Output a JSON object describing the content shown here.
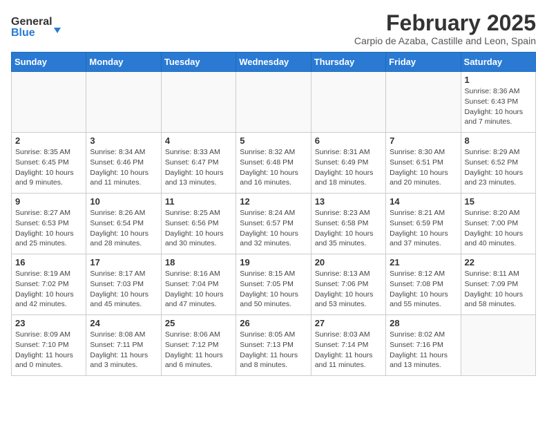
{
  "header": {
    "logo_general": "General",
    "logo_blue": "Blue",
    "month_title": "February 2025",
    "subtitle": "Carpio de Azaba, Castille and Leon, Spain"
  },
  "weekdays": [
    "Sunday",
    "Monday",
    "Tuesday",
    "Wednesday",
    "Thursday",
    "Friday",
    "Saturday"
  ],
  "weeks": [
    [
      {
        "day": "",
        "info": ""
      },
      {
        "day": "",
        "info": ""
      },
      {
        "day": "",
        "info": ""
      },
      {
        "day": "",
        "info": ""
      },
      {
        "day": "",
        "info": ""
      },
      {
        "day": "",
        "info": ""
      },
      {
        "day": "1",
        "info": "Sunrise: 8:36 AM\nSunset: 6:43 PM\nDaylight: 10 hours\nand 7 minutes."
      }
    ],
    [
      {
        "day": "2",
        "info": "Sunrise: 8:35 AM\nSunset: 6:45 PM\nDaylight: 10 hours\nand 9 minutes."
      },
      {
        "day": "3",
        "info": "Sunrise: 8:34 AM\nSunset: 6:46 PM\nDaylight: 10 hours\nand 11 minutes."
      },
      {
        "day": "4",
        "info": "Sunrise: 8:33 AM\nSunset: 6:47 PM\nDaylight: 10 hours\nand 13 minutes."
      },
      {
        "day": "5",
        "info": "Sunrise: 8:32 AM\nSunset: 6:48 PM\nDaylight: 10 hours\nand 16 minutes."
      },
      {
        "day": "6",
        "info": "Sunrise: 8:31 AM\nSunset: 6:49 PM\nDaylight: 10 hours\nand 18 minutes."
      },
      {
        "day": "7",
        "info": "Sunrise: 8:30 AM\nSunset: 6:51 PM\nDaylight: 10 hours\nand 20 minutes."
      },
      {
        "day": "8",
        "info": "Sunrise: 8:29 AM\nSunset: 6:52 PM\nDaylight: 10 hours\nand 23 minutes."
      }
    ],
    [
      {
        "day": "9",
        "info": "Sunrise: 8:27 AM\nSunset: 6:53 PM\nDaylight: 10 hours\nand 25 minutes."
      },
      {
        "day": "10",
        "info": "Sunrise: 8:26 AM\nSunset: 6:54 PM\nDaylight: 10 hours\nand 28 minutes."
      },
      {
        "day": "11",
        "info": "Sunrise: 8:25 AM\nSunset: 6:56 PM\nDaylight: 10 hours\nand 30 minutes."
      },
      {
        "day": "12",
        "info": "Sunrise: 8:24 AM\nSunset: 6:57 PM\nDaylight: 10 hours\nand 32 minutes."
      },
      {
        "day": "13",
        "info": "Sunrise: 8:23 AM\nSunset: 6:58 PM\nDaylight: 10 hours\nand 35 minutes."
      },
      {
        "day": "14",
        "info": "Sunrise: 8:21 AM\nSunset: 6:59 PM\nDaylight: 10 hours\nand 37 minutes."
      },
      {
        "day": "15",
        "info": "Sunrise: 8:20 AM\nSunset: 7:00 PM\nDaylight: 10 hours\nand 40 minutes."
      }
    ],
    [
      {
        "day": "16",
        "info": "Sunrise: 8:19 AM\nSunset: 7:02 PM\nDaylight: 10 hours\nand 42 minutes."
      },
      {
        "day": "17",
        "info": "Sunrise: 8:17 AM\nSunset: 7:03 PM\nDaylight: 10 hours\nand 45 minutes."
      },
      {
        "day": "18",
        "info": "Sunrise: 8:16 AM\nSunset: 7:04 PM\nDaylight: 10 hours\nand 47 minutes."
      },
      {
        "day": "19",
        "info": "Sunrise: 8:15 AM\nSunset: 7:05 PM\nDaylight: 10 hours\nand 50 minutes."
      },
      {
        "day": "20",
        "info": "Sunrise: 8:13 AM\nSunset: 7:06 PM\nDaylight: 10 hours\nand 53 minutes."
      },
      {
        "day": "21",
        "info": "Sunrise: 8:12 AM\nSunset: 7:08 PM\nDaylight: 10 hours\nand 55 minutes."
      },
      {
        "day": "22",
        "info": "Sunrise: 8:11 AM\nSunset: 7:09 PM\nDaylight: 10 hours\nand 58 minutes."
      }
    ],
    [
      {
        "day": "23",
        "info": "Sunrise: 8:09 AM\nSunset: 7:10 PM\nDaylight: 11 hours\nand 0 minutes."
      },
      {
        "day": "24",
        "info": "Sunrise: 8:08 AM\nSunset: 7:11 PM\nDaylight: 11 hours\nand 3 minutes."
      },
      {
        "day": "25",
        "info": "Sunrise: 8:06 AM\nSunset: 7:12 PM\nDaylight: 11 hours\nand 6 minutes."
      },
      {
        "day": "26",
        "info": "Sunrise: 8:05 AM\nSunset: 7:13 PM\nDaylight: 11 hours\nand 8 minutes."
      },
      {
        "day": "27",
        "info": "Sunrise: 8:03 AM\nSunset: 7:14 PM\nDaylight: 11 hours\nand 11 minutes."
      },
      {
        "day": "28",
        "info": "Sunrise: 8:02 AM\nSunset: 7:16 PM\nDaylight: 11 hours\nand 13 minutes."
      },
      {
        "day": "",
        "info": ""
      }
    ]
  ]
}
